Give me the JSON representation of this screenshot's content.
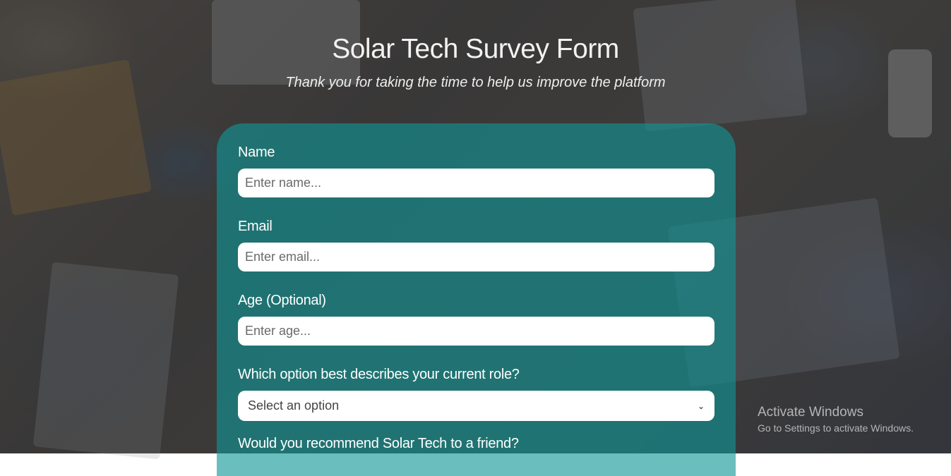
{
  "header": {
    "title": "Solar Tech Survey Form",
    "subtitle": "Thank you for taking the time to help us improve the platform"
  },
  "form": {
    "name": {
      "label": "Name",
      "placeholder": "Enter name..."
    },
    "email": {
      "label": "Email",
      "placeholder": "Enter email..."
    },
    "age": {
      "label": "Age (Optional)",
      "placeholder": "Enter age..."
    },
    "role": {
      "label": "Which option best describes your current role?",
      "selected": "Select an option"
    },
    "recommend": {
      "label": "Would you recommend Solar Tech to a friend?"
    }
  },
  "watermark": {
    "title": "Activate Windows",
    "subtitle": "Go to Settings to activate Windows."
  },
  "colors": {
    "card": "#109696",
    "text": "#ffffff"
  },
  "icons": {
    "select_chevron": "chevron-down-icon"
  }
}
